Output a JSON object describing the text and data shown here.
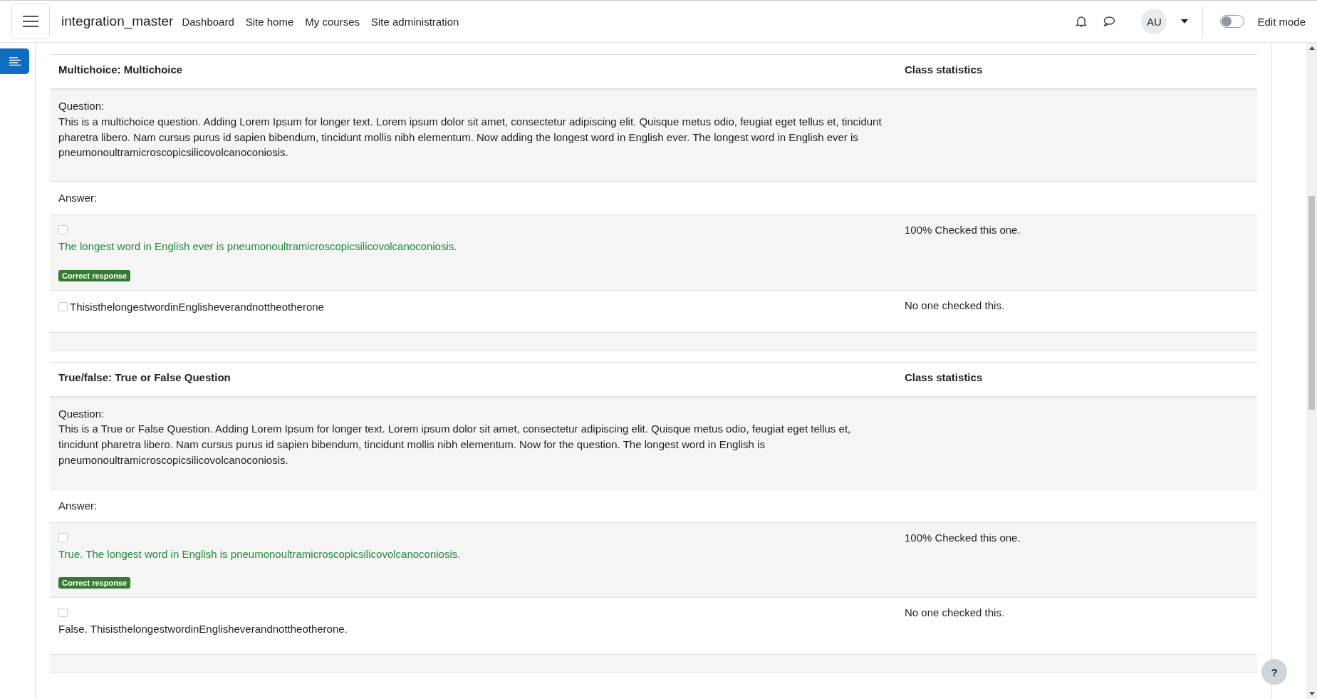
{
  "navbar": {
    "site_name": "integration_master",
    "links": [
      "Dashboard",
      "Site home",
      "My courses",
      "Site administration"
    ],
    "avatar": "AU",
    "edit_mode": {
      "label": "Edit mode",
      "on": false
    }
  },
  "questions": [
    {
      "title": "Multichoice: Multichoice",
      "stats_heading": "Class statistics",
      "question_label": "Question:",
      "question_text": "This is a multichoice question. Adding Lorem Ipsum for longer text. Lorem ipsum dolor sit amet, consectetur adipiscing elit. Quisque metus odio, feugiat eget tellus et, tincidunt pharetra libero. Nam cursus purus id sapien bibendum, tincidunt mollis nibh elementum. Now adding the longest word in English ever. The longest word in English ever is pneumonoultramicroscopicsilicovolcanoconiosis.",
      "answer_label": "Answer:",
      "answers": [
        {
          "text": "The longest word in English ever is pneumonoultramicroscopicsilicovolcanoconiosis.",
          "correct": true,
          "badge": "Correct response",
          "checked": false,
          "stat": "100% Checked this one.",
          "inline": false
        },
        {
          "text": "ThisisthelongestwordinEnglisheverandnottheotherone",
          "correct": false,
          "checked": false,
          "stat": "No one checked this.",
          "inline": true
        }
      ]
    },
    {
      "title": "True/false: True or False Question",
      "stats_heading": "Class statistics",
      "question_label": "Question:",
      "question_text": "This is a True or False Question. Adding Lorem Ipsum for longer text. Lorem ipsum dolor sit amet, consectetur adipiscing elit. Quisque metus odio, feugiat eget tellus et, tincidunt pharetra libero. Nam cursus purus id sapien bibendum, tincidunt mollis nibh elementum. Now for the question. The longest word in English is pneumonoultramicroscopicsilicovolcanoconiosis.",
      "answer_label": "Answer:",
      "answers": [
        {
          "text": "True. The longest word in English is pneumonoultramicroscopicsilicovolcanoconiosis.",
          "correct": true,
          "badge": "Correct response",
          "checked": false,
          "stat": "100% Checked this one.",
          "inline": false
        },
        {
          "text": "False. ThisisthelongestwordinEnglisheverandnottheotherone.",
          "correct": false,
          "checked": false,
          "stat": "No one checked this.",
          "inline": false
        }
      ]
    }
  ],
  "help_button": "?"
}
